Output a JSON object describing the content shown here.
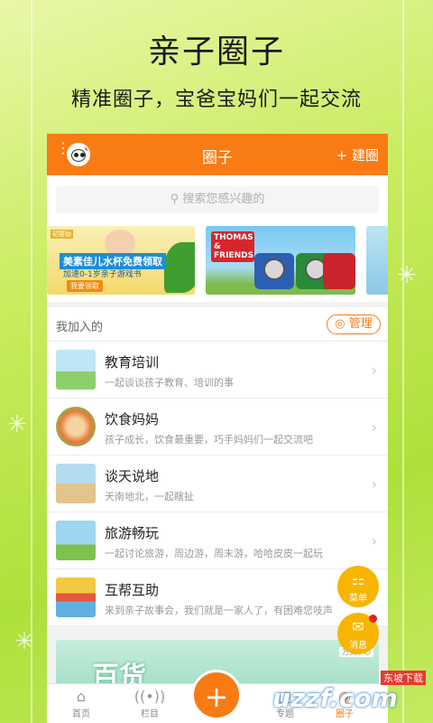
{
  "promo": {
    "title": "亲子圈子",
    "subtitle": "精准圈子，宝爸宝妈们一起交流"
  },
  "topbar": {
    "title": "圈子",
    "create_label": "+ 建圈",
    "menu_icon": "more-vertical-icon",
    "avatar_icon": "panda-avatar-icon"
  },
  "search": {
    "placeholder": "搜索您感兴趣的",
    "icon": "search-icon"
  },
  "banners": [
    {
      "tag": "初婴幼",
      "line1": "美素佳儿水杯免费领取",
      "line2": "加速0-1岁亲子游戏书",
      "button": "我要领取"
    },
    {
      "logo": "THOMAS & FRIENDS"
    },
    {}
  ],
  "joined": {
    "label": "我加入的",
    "manage_label": "管理",
    "manage_icon": "settings-circle-icon"
  },
  "circles": [
    {
      "name": "教育培训",
      "desc": "一起谈谈孩子教育、培训的事"
    },
    {
      "name": "饮食妈妈",
      "desc": "孩子成长，饮食最重要，巧手妈妈们一起交流吧"
    },
    {
      "name": "谈天说地",
      "desc": "天南地北，一起瞎扯"
    },
    {
      "name": "旅游畅玩",
      "desc": "一起讨论旅游，周边游，周末游，哈哈皮皮一起玩"
    },
    {
      "name": "互帮互助",
      "desc": "来到亲子故事会，我们就是一家人了，有困难您吱声"
    }
  ],
  "floating": {
    "menu_label": "菜单",
    "message_label": "消息"
  },
  "below_card": {
    "text": "百货",
    "tag": "万货中心"
  },
  "tabbar": {
    "home": "首页",
    "columns": "栏目",
    "topics": "专题",
    "circles": "圈子"
  },
  "watermark": {
    "logo": "uzzf.com",
    "top": "东坡下载"
  },
  "colors": {
    "accent": "#f87b13",
    "float": "#f7b500",
    "background": "#c8ec5e"
  }
}
